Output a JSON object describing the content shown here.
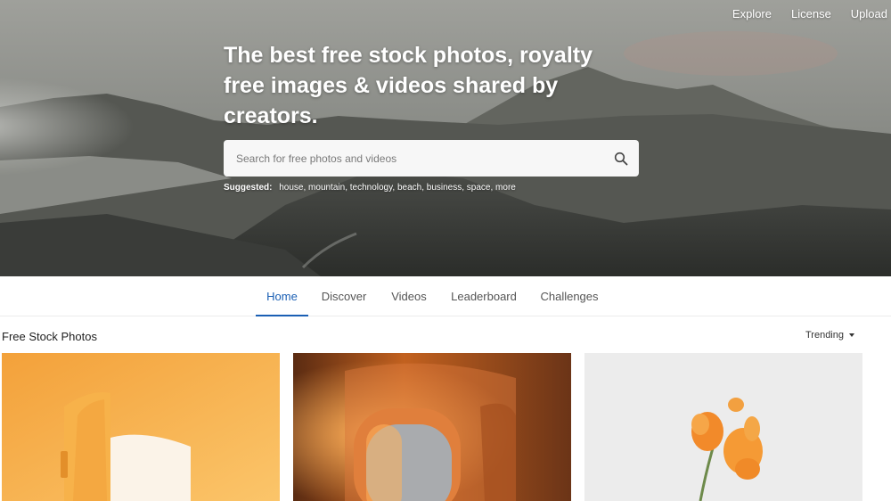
{
  "nav": {
    "explore": "Explore",
    "license": "License",
    "upload": "Upload"
  },
  "hero": {
    "title": "The best free stock photos, royalty free images & videos shared by creators.",
    "search_placeholder": "Search for free photos and videos",
    "suggested_label": "Suggested:",
    "suggestions": [
      "house",
      "mountain",
      "technology",
      "beach",
      "business",
      "space",
      "more"
    ]
  },
  "tabs": [
    "Home",
    "Discover",
    "Videos",
    "Leaderboard",
    "Challenges"
  ],
  "active_tab": "Home",
  "section": {
    "title": "Free Stock Photos",
    "sort_label": "Trending"
  },
  "photos": [
    {
      "name": "orange-doorway"
    },
    {
      "name": "airplane-window"
    },
    {
      "name": "orange-flower"
    }
  ],
  "colors": {
    "accent": "#1a5fb4"
  }
}
